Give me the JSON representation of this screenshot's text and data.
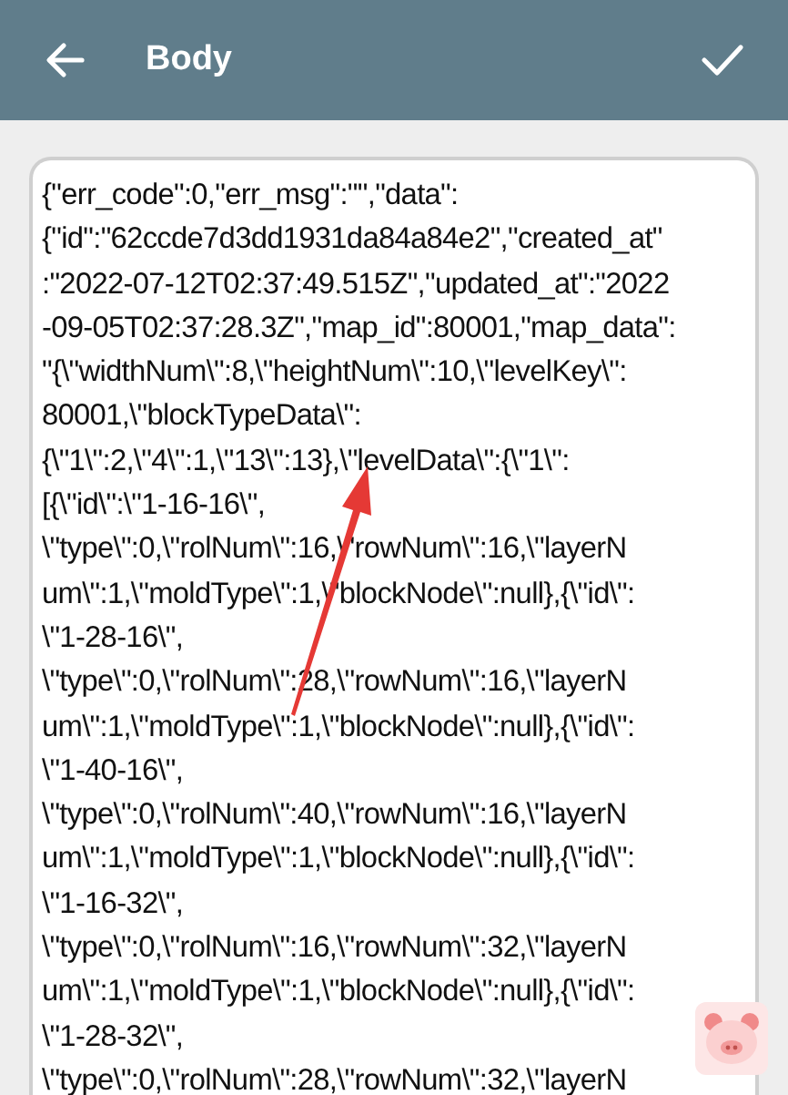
{
  "app_bar": {
    "title": "Body"
  },
  "body_editor": {
    "lines": [
      "{\"err_code\":0,\"err_msg\":\"\",\"data\":",
      "{\"id\":\"62ccde7d3dd1931da84a84e2\",\"created_at\"",
      ":\"2022-07-12T02:37:49.515Z\",\"updated_at\":\"2022",
      "-09-05T02:37:28.3Z\",\"map_id\":80001,\"map_data\":",
      "\"{\\\"widthNum\\\":8,\\\"heightNum\\\":10,\\\"levelKey\\\":",
      "80001,\\\"blockTypeData\\\":",
      "{\\\"1\\\":2,\\\"4\\\":1,\\\"13\\\":13},\\\"levelData\\\":{\\\"1\\\":",
      "[{\\\"id\\\":\\\"1-16-16\\\",",
      "\\\"type\\\":0,\\\"rolNum\\\":16,\\\"rowNum\\\":16,\\\"layerN",
      "um\\\":1,\\\"moldType\\\":1,\\\"blockNode\\\":null},{\\\"id\\\":",
      "\\\"1-28-16\\\",",
      "\\\"type\\\":0,\\\"rolNum\\\":28,\\\"rowNum\\\":16,\\\"layerN",
      "um\\\":1,\\\"moldType\\\":1,\\\"blockNode\\\":null},{\\\"id\\\":",
      "\\\"1-40-16\\\",",
      "\\\"type\\\":0,\\\"rolNum\\\":40,\\\"rowNum\\\":16,\\\"layerN",
      "um\\\":1,\\\"moldType\\\":1,\\\"blockNode\\\":null},{\\\"id\\\":",
      "\\\"1-16-32\\\",",
      "\\\"type\\\":0,\\\"rolNum\\\":16,\\\"rowNum\\\":32,\\\"layerN",
      "um\\\":1,\\\"moldType\\\":1,\\\"blockNode\\\":null},{\\\"id\\\":",
      "\\\"1-28-32\\\",",
      "\\\"type\\\":0,\\\"rolNum\\\":28,\\\"rowNum\\\":32,\\\"layerN"
    ]
  }
}
